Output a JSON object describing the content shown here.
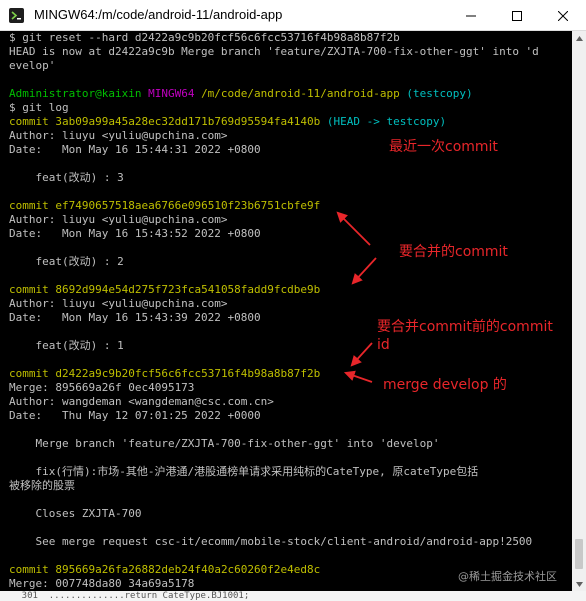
{
  "window": {
    "title": "MINGW64:/m/code/android-11/android-app",
    "controls": {
      "minimize": "—",
      "maximize": "☐",
      "close": "✕"
    }
  },
  "terminal": {
    "lines": [
      "$ git reset --hard d2422a9c9b20fcf56c6fcc53716f4b98a8b87f2b",
      "HEAD is now at d2422a9c9b Merge branch 'feature/ZXJTA-700-fix-other-ggt' into 'd",
      "evelop'",
      "",
      {
        "user": "Administrator@kaixin",
        "shell": "MINGW64",
        "path": "/m/code/android-11/android-app",
        "branch": "(testcopy)"
      },
      "$ git log",
      {
        "hash_label": "commit",
        "hash": "3ab09a99a45a28ec32dd171b769d95594fa4140b",
        "head": "(HEAD -> testcopy)"
      },
      "Author: liuyu <yuliu@upchina.com>",
      "Date:   Mon May 16 15:44:31 2022 +0800",
      "",
      "    feat(改动) : 3",
      "",
      {
        "hash_label": "commit",
        "hash": "ef7490657518aea6766e096510f23b6751cbfe9f"
      },
      "Author: liuyu <yuliu@upchina.com>",
      "Date:   Mon May 16 15:43:52 2022 +0800",
      "",
      "    feat(改动) : 2",
      "",
      {
        "hash_label": "commit",
        "hash": "8692d994e54d275f723fca541058fadd9fcdbe9b"
      },
      "Author: liuyu <yuliu@upchina.com>",
      "Date:   Mon May 16 15:43:39 2022 +0800",
      "",
      "    feat(改动) : 1",
      "",
      {
        "hash_label": "commit",
        "hash": "d2422a9c9b20fcf56c6fcc53716f4b98a8b87f2b"
      },
      "Merge: 895669a26f 0ec4095173",
      "Author: wangdeman <wangdeman@csc.com.cn>",
      "Date:   Thu May 12 07:01:25 2022 +0000",
      "",
      "    Merge branch 'feature/ZXJTA-700-fix-other-ggt' into 'develop'",
      "",
      "    fix(行情):市场-其他-沪港通/港股通榜单请求采用纯标的CateType, 原cateType包括",
      "被移除的股票",
      "",
      "    Closes ZXJTA-700",
      "",
      "    See merge request csc-it/ecomm/mobile-stock/client-android/android-app!2500",
      "",
      {
        "hash_label": "commit",
        "hash": "895669a26fa26882deb24f40a2c60260f2e4ed8c"
      },
      "Merge: 007748da80 34a69a5178"
    ],
    "underlying_strip": "    301  ..............return CateType.BJ1001;"
  },
  "annotations": {
    "latest_commit": "最近一次commit",
    "to_merge": "要合并的commit",
    "before_merge_line1": "要合并commit前的commit",
    "before_merge_line2": "id",
    "merge_develop": "merge develop 的"
  },
  "colors": {
    "annotation": "#e8262a",
    "hash": "#bfbf00",
    "user": "#00bf00",
    "shell": "#bf00bf",
    "path": "#bfbf00",
    "branch": "#00bfbf",
    "head": "#00bfbf"
  },
  "watermark": "@稀土掘金技术社区"
}
